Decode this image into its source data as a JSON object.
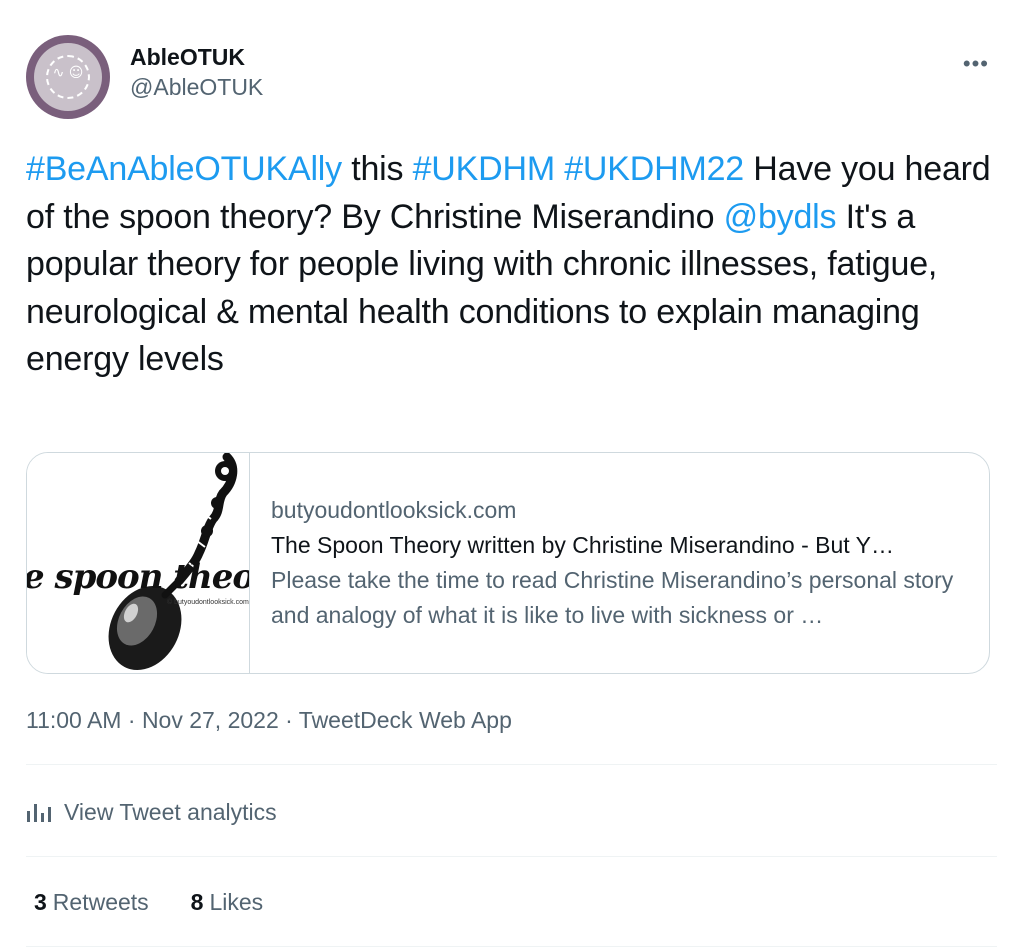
{
  "author": {
    "display_name": "AbleOTUK",
    "handle": "@AbleOTUK"
  },
  "more_label": "•••",
  "tweet": {
    "segments": [
      {
        "text": "#BeAnAbleOTUKAlly",
        "link": true
      },
      {
        "text": " this ",
        "link": false
      },
      {
        "text": "#UKDHM",
        "link": true
      },
      {
        "text": " ",
        "link": false
      },
      {
        "text": "#UKDHM22",
        "link": true
      },
      {
        "text": " Have you heard of the spoon theory? By Christine Miserandino ",
        "link": false
      },
      {
        "text": "@bydls",
        "link": true
      },
      {
        "text": " It's a popular theory for people living with chronic illnesses, fatigue, neurological  & mental health conditions to explain managing energy levels",
        "link": false
      }
    ]
  },
  "card": {
    "domain": "butyoudontlooksick.com",
    "title": "The Spoon Theory written by Christine Miserandino - But Y…",
    "description": "Please take the time to read Christine Miserandino’s personal story and analogy of what it is like to live with sickness or …",
    "thumb_text": "e spoon theo",
    "thumb_credit": "© butyoudontlooksick.com"
  },
  "meta": {
    "time": "11:00 AM",
    "date": "Nov 27, 2022",
    "source": "TweetDeck Web App"
  },
  "analytics_label": "View Tweet analytics",
  "stats": {
    "retweets_count": "3",
    "retweets_label": "Retweets",
    "likes_count": "8",
    "likes_label": "Likes"
  },
  "colors": {
    "link": "#1d9bf0",
    "secondary_text": "#536471",
    "primary_text": "#0f1419",
    "avatar_bg": "#7a5f7c"
  },
  "icons": [
    "more-icon",
    "analytics-bar-icon"
  ]
}
